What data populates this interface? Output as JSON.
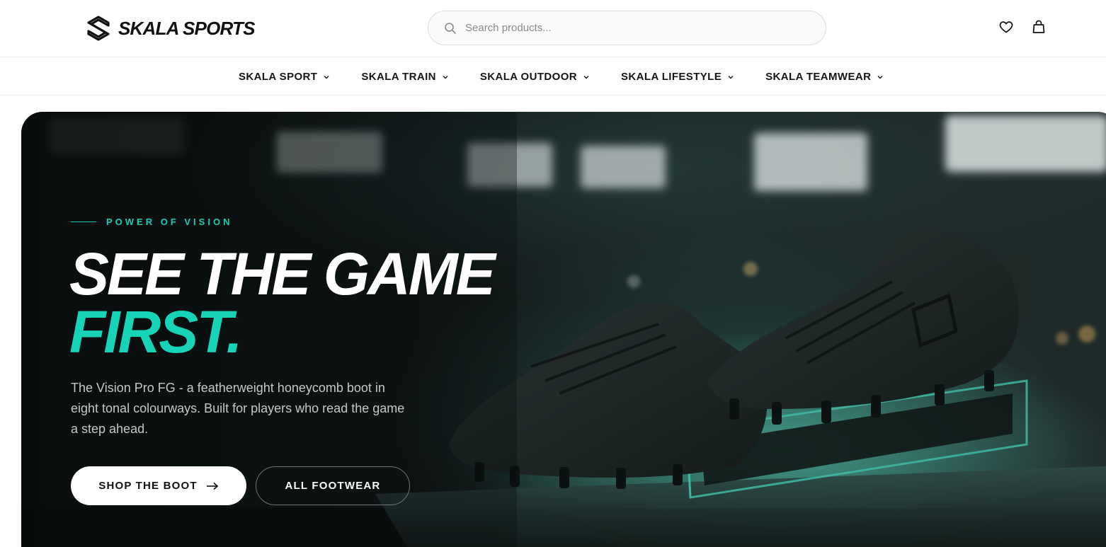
{
  "brand": {
    "name": "SKALA SPORTS",
    "logo_icon": "skala-s-logo"
  },
  "search": {
    "placeholder": "Search products...",
    "icon": "search-icon"
  },
  "header_icons": [
    {
      "name": "wishlist",
      "icon": "heart-icon"
    },
    {
      "name": "cart",
      "icon": "shopping-bag-icon"
    }
  ],
  "nav": {
    "items": [
      {
        "label": "SKALA SPORT"
      },
      {
        "label": "SKALA TRAIN"
      },
      {
        "label": "SKALA OUTDOOR"
      },
      {
        "label": "SKALA LIFESTYLE"
      },
      {
        "label": "SKALA TEAMWEAR"
      }
    ]
  },
  "hero": {
    "eyebrow": "POWER OF VISION",
    "headline_line1": "SEE THE GAME",
    "headline_line2": "FIRST.",
    "description": "The Vision Pro FG - a featherweight honeycomb boot in eight tonal colourways. Built for players who read the game a step ahead.",
    "primary_button": "SHOP THE BOOT",
    "primary_button_icon": "arrow-right-icon",
    "secondary_button": "ALL FOOTWEAR"
  },
  "colors": {
    "accent": "#17d4b8",
    "hero_background": "#0f1414",
    "text_dark": "#111111"
  }
}
